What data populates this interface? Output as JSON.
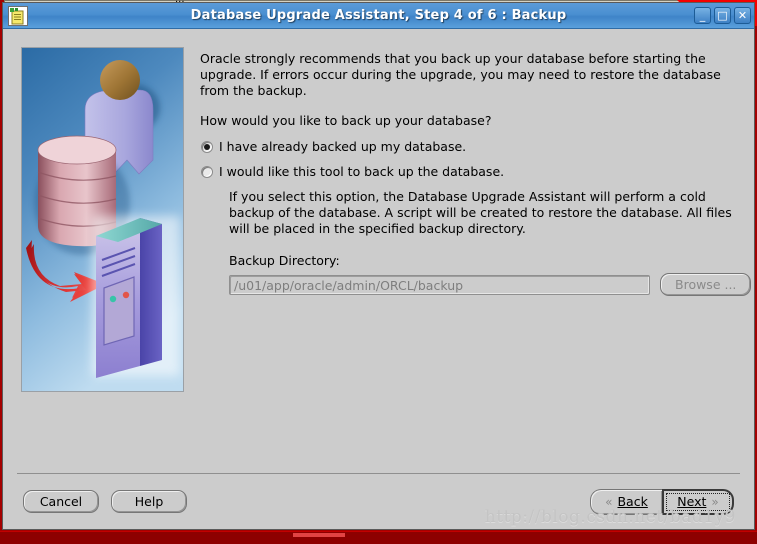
{
  "window": {
    "title": "Database Upgrade Assistant, Step 4 of 6 : Backup",
    "icon": "document-list-icon",
    "buttons": {
      "minimize": "_",
      "maximize": "□",
      "close": "✕"
    }
  },
  "background_window": {
    "title_fragment": "···",
    "button_count": 3
  },
  "content": {
    "intro": "Oracle strongly recommends that you back up your database before starting the upgrade. If errors occur during the upgrade, you may need to restore the database from the backup.",
    "question": "How would you like to back up your database?",
    "options": [
      {
        "label": "I have already backed up my database.",
        "selected": true
      },
      {
        "label": "I would like this tool to back up the database.",
        "selected": false
      }
    ],
    "option_description": "If you select this option, the Database Upgrade Assistant will perform a cold backup of the database. A script will be created to restore the database. All files will be placed in the specified backup directory.",
    "backup_directory": {
      "label": "Backup Directory:",
      "value": "/u01/app/oracle/admin/ORCL/backup",
      "enabled": false
    },
    "browse_button": "Browse ..."
  },
  "footer": {
    "cancel": "Cancel",
    "help": "Help",
    "back": "Back",
    "next": "Next",
    "back_chevron": "«",
    "next_chevron": "»"
  },
  "watermark": "http://blog.csdn.net/bad1y9",
  "colors": {
    "titlebar_blue": "#4a8fd1",
    "dialog_gray": "#cccccc",
    "desktop_red": "#a40000",
    "taskbar_red": "#8d0000",
    "accent_red": "#f50000",
    "disabled_text": "#7e7e7e"
  }
}
